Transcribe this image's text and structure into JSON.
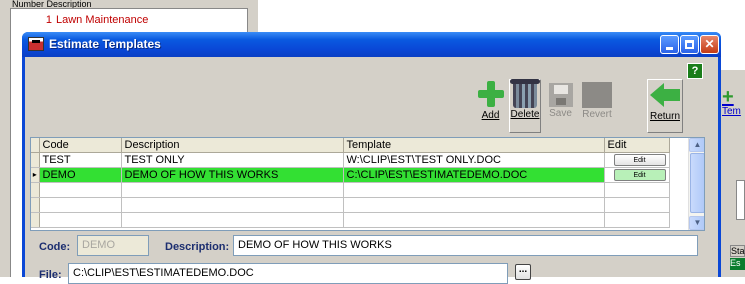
{
  "background": {
    "grid_header": "Number  Description",
    "grid_row": {
      "number": "1",
      "description": "Lawn Maintenance"
    },
    "side_button_label": "Tem",
    "side_labels": [
      "Sta",
      "Es"
    ]
  },
  "dialog": {
    "title": "Estimate Templates",
    "help_label": "?",
    "toolbar": {
      "add": "Add",
      "delete": "Delete",
      "save": "Save",
      "revert": "Revert",
      "return": "Return"
    },
    "grid": {
      "columns": [
        "Code",
        "Description",
        "Template",
        "Edit"
      ],
      "rows": [
        {
          "code": "TEST",
          "description": "TEST ONLY",
          "template": "W:\\CLIP\\EST\\TEST ONLY.DOC",
          "edit": "Edit",
          "selected": false
        },
        {
          "code": "DEMO",
          "description": "DEMO OF HOW THIS WORKS",
          "template": "C:\\CLIP\\EST\\ESTIMATEDEMO.DOC",
          "edit": "Edit",
          "selected": true
        }
      ]
    },
    "form": {
      "code_label": "Code:",
      "code_value": "DEMO",
      "description_label": "Description:",
      "description_value": "DEMO OF HOW THIS WORKS",
      "file_label": "File:",
      "file_value": "C:\\CLIP\\EST\\ESTIMATEDEMO.DOC",
      "browse_label": "..."
    }
  },
  "colors": {
    "title_bar": "#0a47d6",
    "selected_row": "#33e033",
    "accent_green": "#3cb043"
  }
}
